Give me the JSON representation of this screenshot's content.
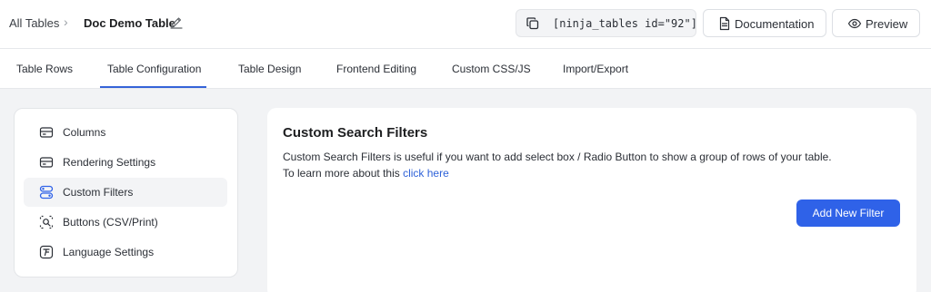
{
  "breadcrumb": {
    "root": "All Tables",
    "separator": "›",
    "current": "Doc Demo Table"
  },
  "header": {
    "shortcode": "[ninja_tables id=\"92\"]",
    "documentation_label": "Documentation",
    "preview_label": "Preview"
  },
  "tabs": [
    {
      "label": "Table Rows",
      "active": false
    },
    {
      "label": "Table Configuration",
      "active": true
    },
    {
      "label": "Table Design",
      "active": false
    },
    {
      "label": "Frontend Editing",
      "active": false
    },
    {
      "label": "Custom CSS/JS",
      "active": false
    },
    {
      "label": "Import/Export",
      "active": false
    }
  ],
  "sidebar": {
    "items": [
      {
        "label": "Columns",
        "icon": "columns-icon",
        "active": false
      },
      {
        "label": "Rendering Settings",
        "icon": "rendering-settings-icon",
        "active": false
      },
      {
        "label": "Custom Filters",
        "icon": "custom-filters-icon",
        "active": true
      },
      {
        "label": "Buttons (CSV/Print)",
        "icon": "buttons-icon",
        "active": false
      },
      {
        "label": "Language Settings",
        "icon": "language-icon",
        "active": false
      }
    ]
  },
  "panel": {
    "title": "Custom Search Filters",
    "description": "Custom Search Filters is useful if you want to add select box / Radio Button to show a group of rows of your table.",
    "learn_more_prefix": "To learn more about this ",
    "learn_more_link": "click here",
    "add_button": "Add New Filter"
  },
  "colors": {
    "accent": "#2f62e8",
    "link": "#2f62d8",
    "tab_indicator": "#3563d8",
    "content_background": "#f2f3f5"
  }
}
